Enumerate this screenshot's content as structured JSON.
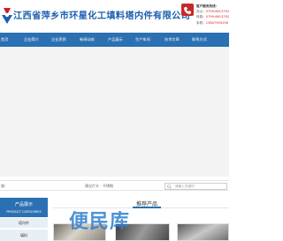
{
  "header": {
    "company_name": "江西省萍乡市环星化工填料塔内件有限公司",
    "hotline": {
      "title": "客户服务热线：",
      "phone_label": "办公：",
      "phone_value": "0799-6613792",
      "fax_label": "传真：",
      "fax_value": "0799-6613792",
      "mobile_label": "手机：",
      "mobile_value": "13807993256"
    }
  },
  "nav": {
    "items": [
      {
        "label": "首页"
      },
      {
        "label": "企业简介"
      },
      {
        "label": "企业资质"
      },
      {
        "label": "新闻动态"
      },
      {
        "label": "产品展示"
      },
      {
        "label": "生产车间"
      },
      {
        "label": "技术文章"
      },
      {
        "label": "联系方式"
      }
    ]
  },
  "breadcrumb": {
    "left": "路：",
    "location": "建议片头 - 不锈钢"
  },
  "search": {
    "placeholder": "请输入关键词"
  },
  "sidebar": {
    "title": "产品展示",
    "subtitle": "PRODUCT CATEGORIES",
    "items": [
      {
        "label": "塔内件"
      },
      {
        "label": "填料"
      }
    ]
  },
  "main": {
    "title": "推荐产品"
  },
  "watermark": "便民库",
  "colors": {
    "brand_blue": "#2b70b2",
    "hotline_red": "#c42a2a",
    "watermark_blue": "#2f7fd0"
  }
}
